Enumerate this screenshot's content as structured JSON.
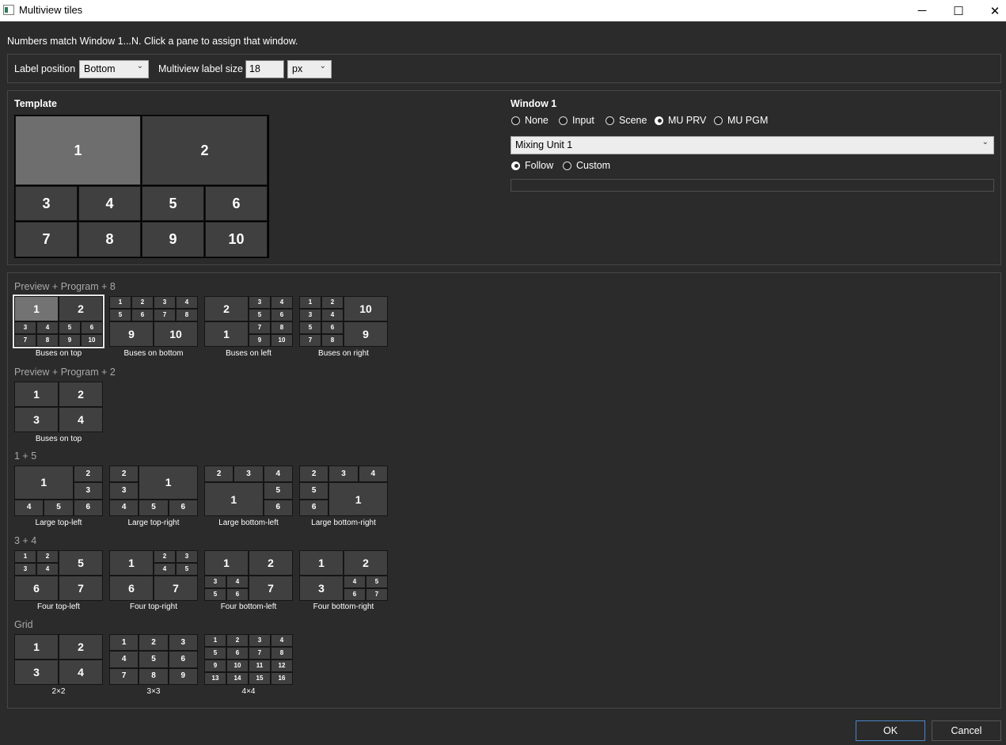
{
  "window": {
    "title": "Multiview tiles",
    "minimize": "─",
    "maximize": "☐",
    "close": "✕"
  },
  "hint": "Numbers match Window 1...N. Click a pane to assign that window.",
  "options": {
    "label_position_label": "Label position",
    "label_position_value": "Bottom",
    "label_size_label": "Multiview label size",
    "label_size_value": "18",
    "unit_value": "px"
  },
  "template": {
    "heading": "Template",
    "cells": [
      "1",
      "2",
      "3",
      "4",
      "5",
      "6",
      "7",
      "8",
      "9",
      "10"
    ]
  },
  "window_settings": {
    "heading": "Window 1",
    "sources": [
      "None",
      "Input",
      "Scene",
      "MU PRV",
      "MU PGM"
    ],
    "selected_source": "MU PRV",
    "mixing_unit": "Mixing Unit 1",
    "modes": [
      "Follow",
      "Custom"
    ],
    "selected_mode": "Follow"
  },
  "layouts": {
    "s1": "Preview + Program + 8",
    "s2": "Preview + Program + 2",
    "s3": "1 + 5",
    "s4": "3 + 4",
    "s5": "Grid",
    "captions": {
      "p8_top": "Buses on top",
      "p8_bottom": "Buses on bottom",
      "p8_left": "Buses on left",
      "p8_right": "Buses on right",
      "p2_top": "Buses on top",
      "l_tl": "Large top-left",
      "l_tr": "Large top-right",
      "l_bl": "Large bottom-left",
      "l_br": "Large bottom-right",
      "f_tl": "Four top-left",
      "f_tr": "Four top-right",
      "f_bl": "Four bottom-left",
      "f_br": "Four bottom-right",
      "g2": "2×2",
      "g3": "3×3",
      "g4": "4×4"
    },
    "selected": "p8_top"
  },
  "buttons": {
    "ok": "OK",
    "cancel": "Cancel"
  },
  "icons": {
    "app": "window-icon",
    "dropdown": "chevron-down-icon"
  }
}
